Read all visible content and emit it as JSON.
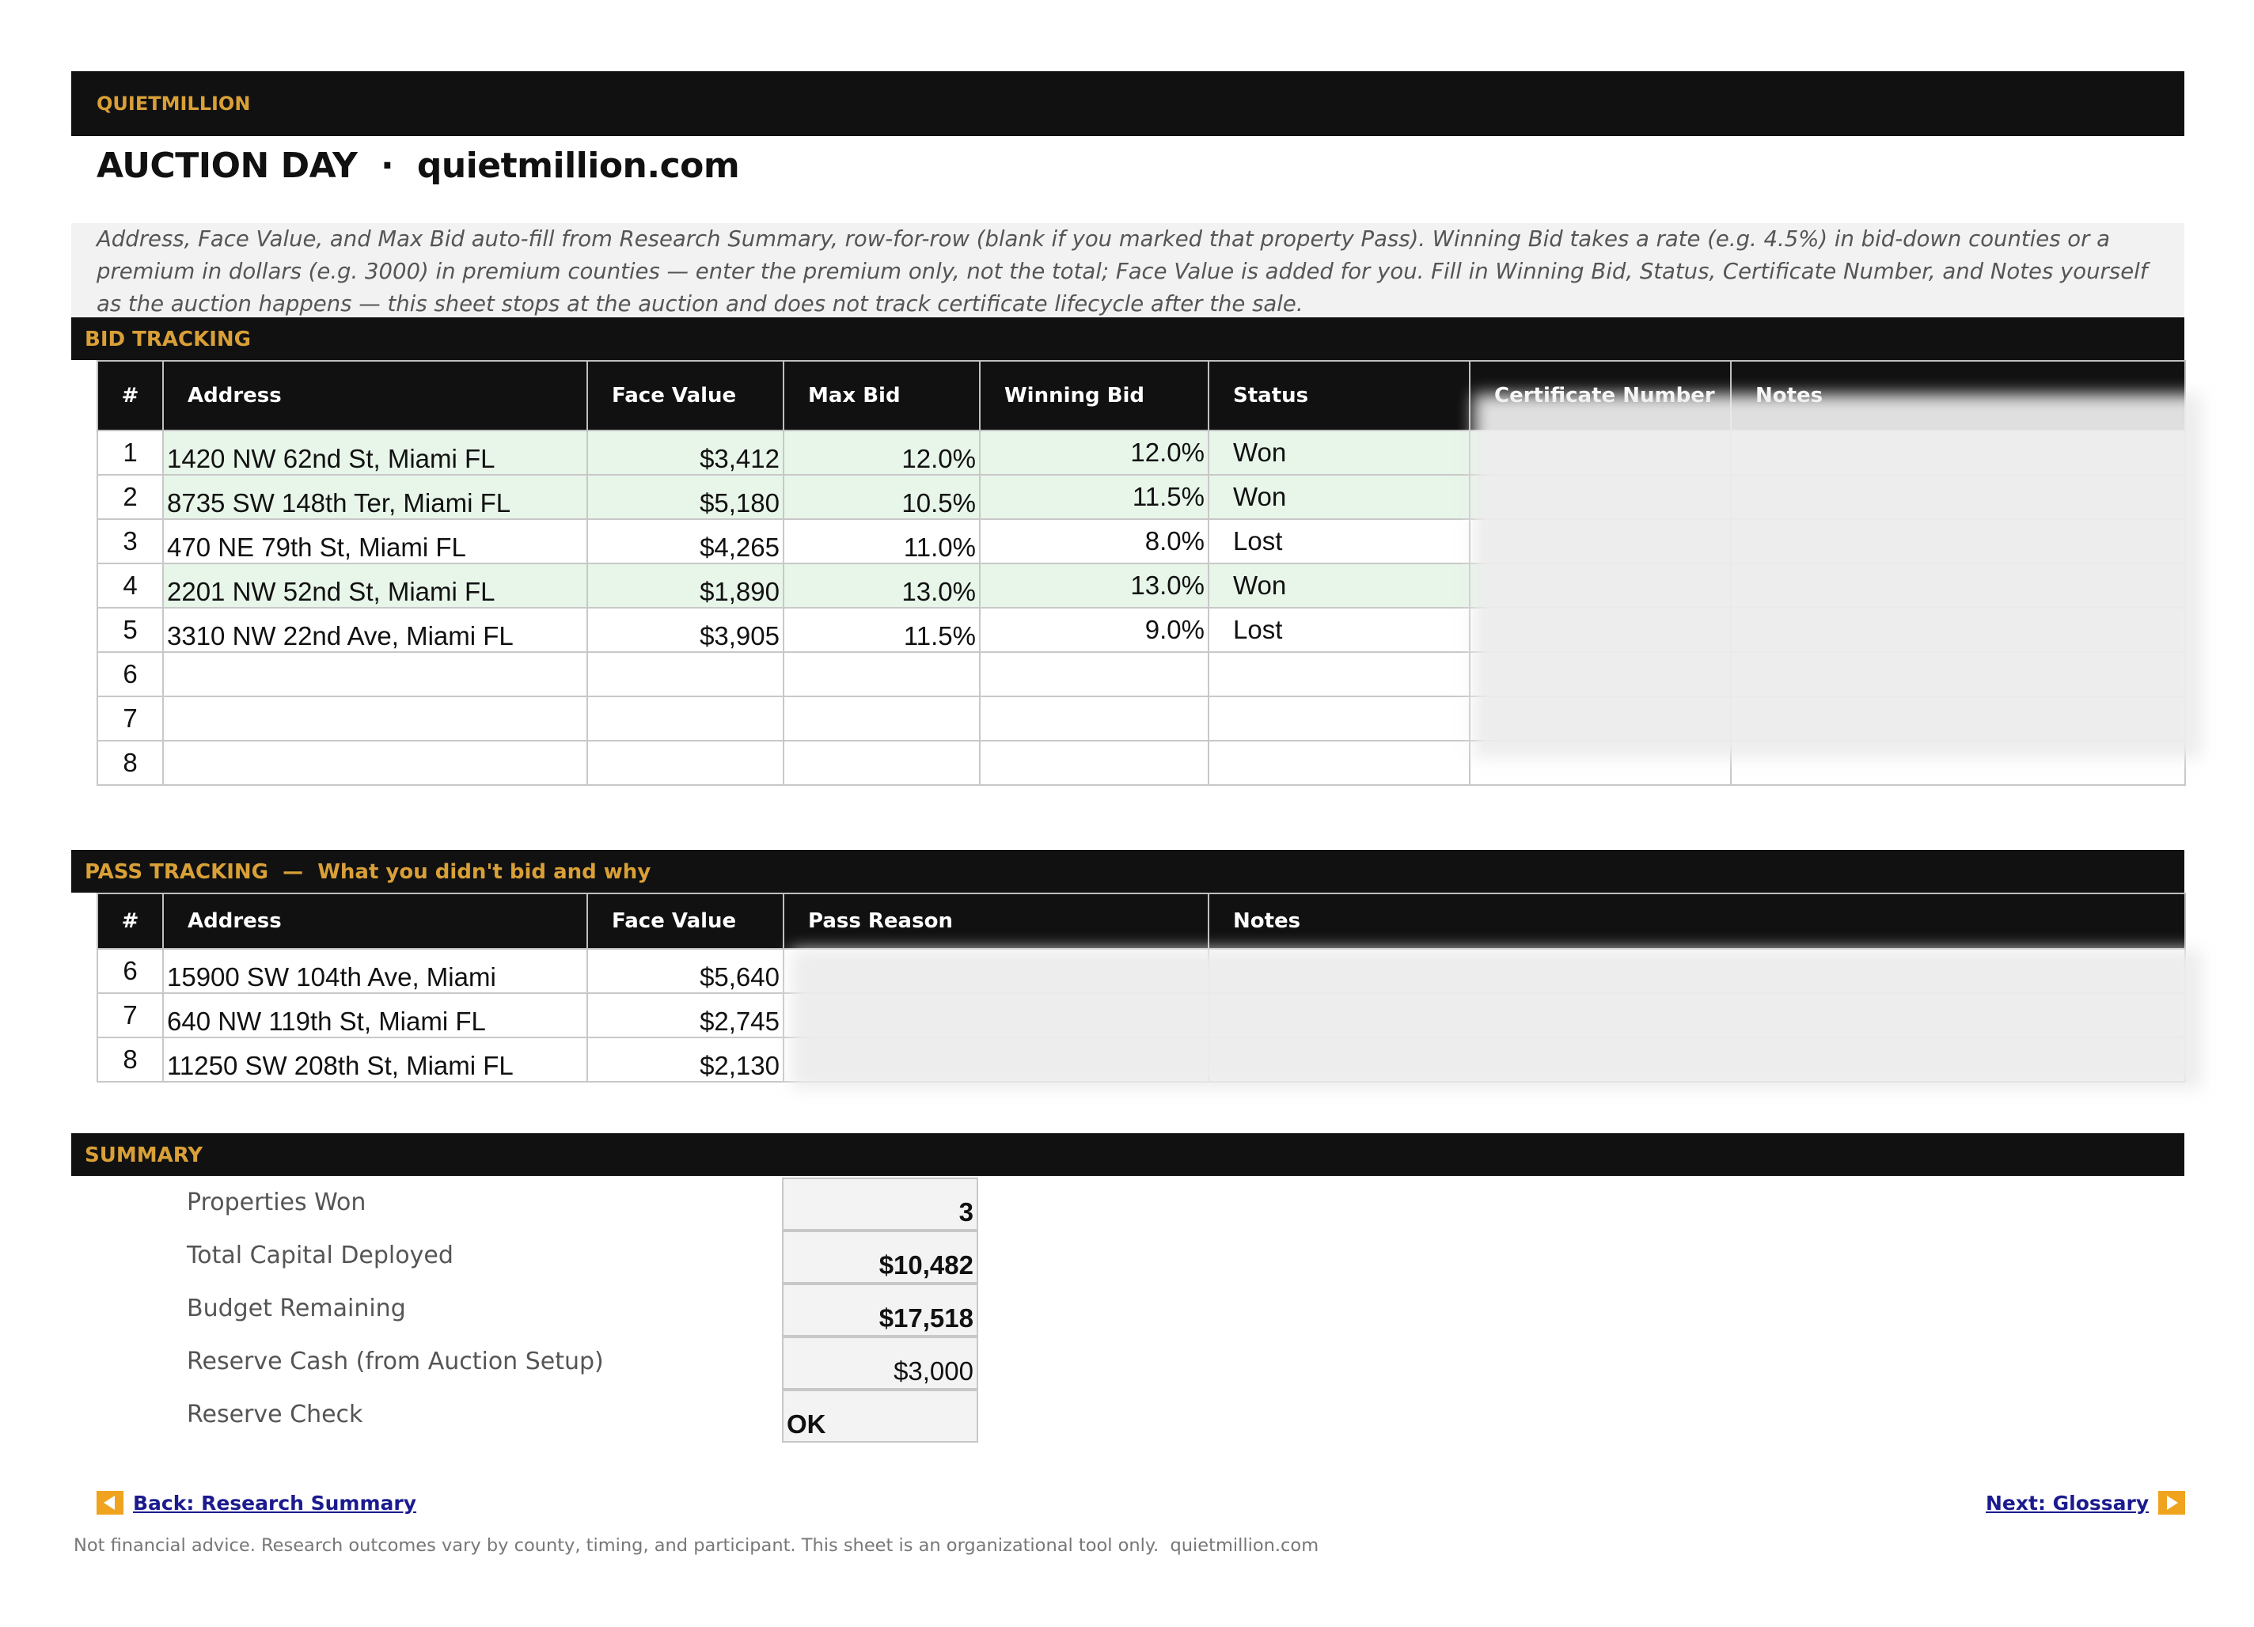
{
  "brand": "QUIETMILLION",
  "title": "AUCTION DAY  ·  quietmillion.com",
  "instructions": "Address, Face Value, and Max Bid auto-fill from Research Summary, row-for-row (blank if you marked that property Pass). Winning Bid takes a rate (e.g. 4.5%) in bid-down counties or a premium in dollars (e.g. 3000) in premium counties — enter the premium only, not the total; Face Value is added for you. Fill in Winning Bid, Status, Certificate Number, and Notes yourself as the auction happens — this sheet stops at the auction and does not track certificate lifecycle after the sale.",
  "colors": {
    "band": "#111111",
    "accent": "#D9A037",
    "won_row": "#e8f5e9",
    "link": "#1b1b8f"
  },
  "bid_tracking": {
    "title": "BID TRACKING",
    "headers": [
      "#",
      "Address",
      "Face Value",
      "Max Bid",
      "Winning Bid",
      "Status",
      "Certificate Number",
      "Notes"
    ],
    "rows": [
      {
        "num": "1",
        "address": "1420 NW 62nd St, Miami FL",
        "face": "$3,412",
        "max": "12.0%",
        "winning": "12.0%",
        "status": "Won"
      },
      {
        "num": "2",
        "address": "8735 SW 148th Ter, Miami FL",
        "face": "$5,180",
        "max": "10.5%",
        "winning": "11.5%",
        "status": "Won"
      },
      {
        "num": "3",
        "address": "470 NE 79th St, Miami FL",
        "face": "$4,265",
        "max": "11.0%",
        "winning": "8.0%",
        "status": "Lost"
      },
      {
        "num": "4",
        "address": "2201 NW 52nd St, Miami FL",
        "face": "$1,890",
        "max": "13.0%",
        "winning": "13.0%",
        "status": "Won"
      },
      {
        "num": "5",
        "address": "3310 NW 22nd Ave, Miami FL",
        "face": "$3,905",
        "max": "11.5%",
        "winning": "9.0%",
        "status": "Lost"
      },
      {
        "num": "6",
        "address": "",
        "face": "",
        "max": "",
        "winning": "",
        "status": ""
      },
      {
        "num": "7",
        "address": "",
        "face": "",
        "max": "",
        "winning": "",
        "status": ""
      },
      {
        "num": "8",
        "address": "",
        "face": "",
        "max": "",
        "winning": "",
        "status": ""
      }
    ]
  },
  "pass_tracking": {
    "title": "PASS TRACKING  —  What you didn't bid and why",
    "headers": [
      "#",
      "Address",
      "Face Value",
      "Pass Reason",
      "Notes"
    ],
    "rows": [
      {
        "num": "6",
        "address": "15900 SW 104th Ave, Miami",
        "face": "$5,640"
      },
      {
        "num": "7",
        "address": "640 NW 119th St, Miami FL",
        "face": "$2,745"
      },
      {
        "num": "8",
        "address": "11250 SW 208th St, Miami FL",
        "face": "$2,130"
      }
    ]
  },
  "summary": {
    "title": "SUMMARY",
    "items": [
      {
        "label": "Properties Won",
        "value": "3"
      },
      {
        "label": "Total Capital Deployed",
        "value": "$10,482"
      },
      {
        "label": "Budget Remaining",
        "value": "$17,518"
      },
      {
        "label": "Reserve Cash (from Auction Setup)",
        "value": "$3,000"
      },
      {
        "label": "Reserve Check",
        "value": "OK"
      }
    ]
  },
  "nav": {
    "back": "Back: Research Summary",
    "next": "Next: Glossary"
  },
  "footer": "Not financial advice. Research outcomes vary by county, timing, and participant. This sheet is an organizational tool only.  quietmillion.com"
}
